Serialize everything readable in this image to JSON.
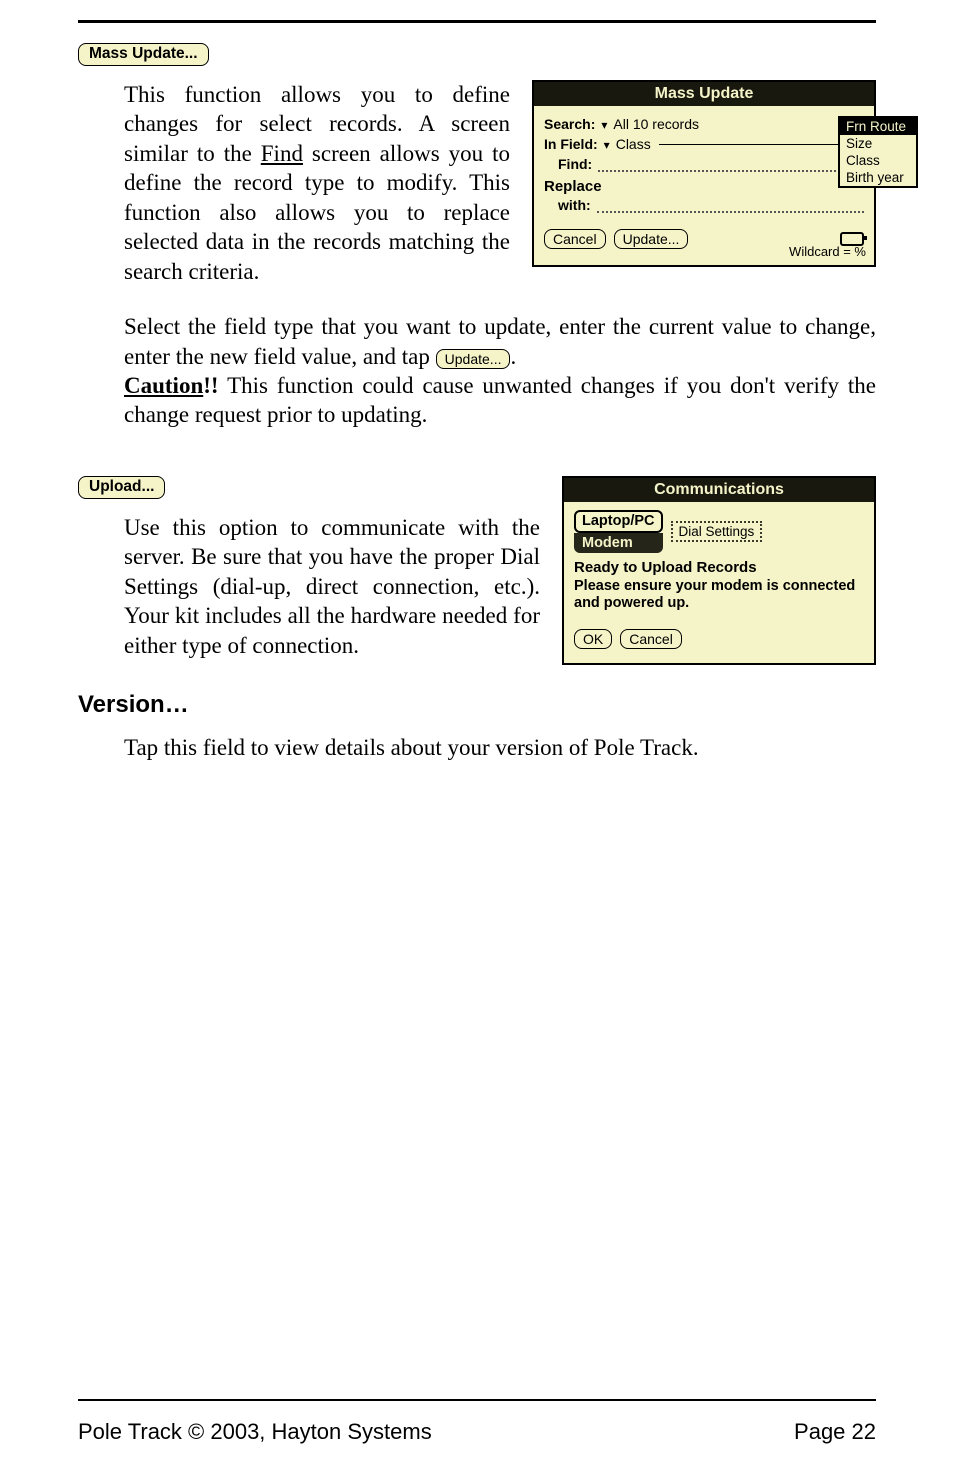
{
  "buttons": {
    "mass_update": "Mass Update...",
    "upload": "Upload...",
    "update_inline": "Update...",
    "cancel": "Cancel",
    "update": "Update...",
    "ok": "OK",
    "cancel2": "Cancel",
    "dial_settings": "Dial Settings"
  },
  "mass_update": {
    "para": "This function allows you to define changes for select records. A screen similar to the ",
    "find_link": "Find",
    "para_after_find": " screen allows you to define the record type to modify. This function also allows you to replace selected data in the records matching the search criteria.",
    "select_para_1": "Select the field type that you want to update, enter the current value to change, enter the new field value, and tap ",
    "select_para_2": ".",
    "caution_label": "Caution",
    "caution_bang": "!!",
    "caution_rest": "  This function could cause unwanted changes if you don't verify the change request prior to updating."
  },
  "mu_window": {
    "title": "Mass Update",
    "search_lbl": "Search:",
    "search_val": "All 10 records",
    "infield_lbl": "In Field:",
    "infield_val": "Class",
    "find_lbl": "Find:",
    "replace_lbl": "Replace",
    "with_lbl": "with:",
    "wildcard": "Wildcard = %",
    "popup": [
      "Frn Route",
      "Size",
      "Class",
      "Birth year"
    ]
  },
  "upload": {
    "para": "Use this option to communicate with the server. Be sure that you have the proper Dial Settings (dial-up, direct connection, etc.). Your kit includes all the hardware needed for either type of connection."
  },
  "comm_window": {
    "title": "Communications",
    "tab_active": "Laptop/PC",
    "tab_inactive": "Modem",
    "ready": "Ready to Upload Records",
    "msg": "Please ensure your modem is connected and powered up."
  },
  "version": {
    "heading": "Version…",
    "para": "Tap this field to view details about your version of Pole Track."
  },
  "footer": {
    "left": "Pole Track © 2003, Hayton Systems",
    "right": "Page 22"
  }
}
